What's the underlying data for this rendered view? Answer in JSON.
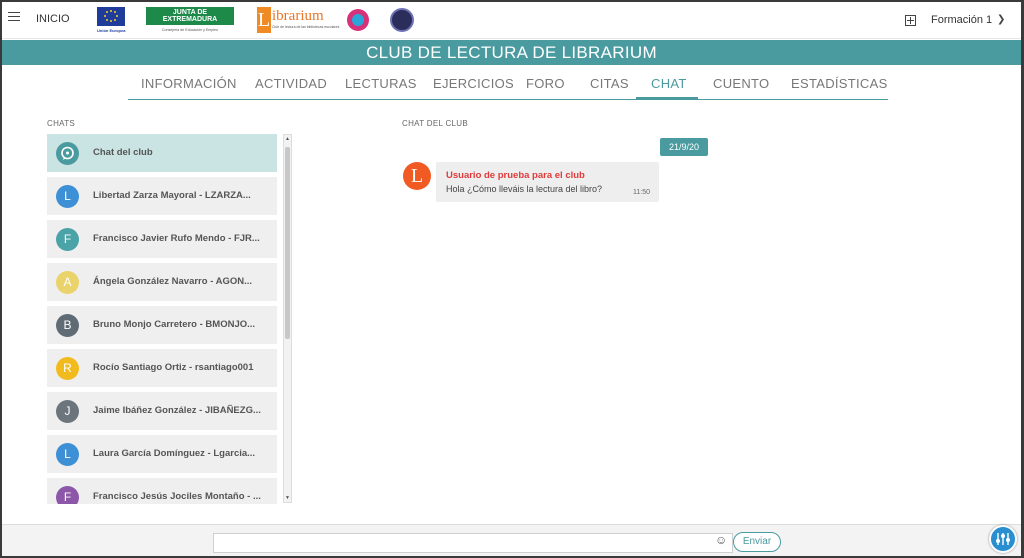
{
  "topbar": {
    "home_label": "INICIO",
    "eu_logo_text": "Unión Europea",
    "junta_logo_title": "JUNTA DE EXTREMADURA",
    "junta_logo_subtitle": "Consejería de Educación y Empleo",
    "librarium_logo_letter": "L",
    "librarium_logo_word": "ibrarium",
    "librarium_logo_subtitle": "Club de lectura de las bibliotecas escolares",
    "user_menu_label": "Formación 1",
    "icons": [
      "menu-icon",
      "add-icon",
      "chevron-down-icon"
    ]
  },
  "header": {
    "title": "CLUB DE LECTURA DE LIBRARIUM"
  },
  "nav": {
    "tabs": [
      {
        "label": "INFORMACIÓN"
      },
      {
        "label": "ACTIVIDAD"
      },
      {
        "label": "LECTURAS"
      },
      {
        "label": "EJERCICIOS"
      },
      {
        "label": "FORO"
      },
      {
        "label": "CITAS"
      },
      {
        "label": "CHAT"
      },
      {
        "label": "CUENTO"
      },
      {
        "label": "ESTADÍSTICAS"
      }
    ],
    "active_tab": "CHAT"
  },
  "chats": {
    "title": "CHATS",
    "items": [
      {
        "name": "Chat del club",
        "avatar": "",
        "color": "#4a9ba0"
      },
      {
        "name": "Libertad Zarza Mayoral - LZARZA...",
        "avatar": "L",
        "color": "#3d8fd6"
      },
      {
        "name": "Francisco Javier Rufo Mendo - FJR...",
        "avatar": "F",
        "color": "#4aa3a7"
      },
      {
        "name": "Ángela González Navarro - AGON...",
        "avatar": "A",
        "color": "#e9d36a"
      },
      {
        "name": "Bruno Monjo Carretero - BMONJO...",
        "avatar": "B",
        "color": "#5f6b75"
      },
      {
        "name": "Rocío Santiago Ortiz - rsantiago001",
        "avatar": "R",
        "color": "#f2bb1d"
      },
      {
        "name": "Jaime Ibáñez González - JIBAÑEZG...",
        "avatar": "J",
        "color": "#6c757c"
      },
      {
        "name": "Laura García Domínguez - Lgarcia...",
        "avatar": "L",
        "color": "#3d8fd6"
      },
      {
        "name": "Francisco Jesús Jociles Montaño - ...",
        "avatar": "F",
        "color": "#8c57a8"
      }
    ]
  },
  "conversation": {
    "title": "CHAT DEL CLUB",
    "date": "21/9/20",
    "messages": [
      {
        "avatar": "L",
        "author": "Usuario de prueba para el club",
        "text": "Hola ¿Cómo lleváis la lectura del libro?",
        "time": "11:50"
      }
    ]
  },
  "composer": {
    "input_value": "",
    "input_placeholder": "",
    "send_label": "Enviar",
    "emoji_glyph": "☺"
  },
  "colors": {
    "accent": "#4a9ba0",
    "author": "#e03a3a",
    "fab": "#2a8fd1"
  }
}
